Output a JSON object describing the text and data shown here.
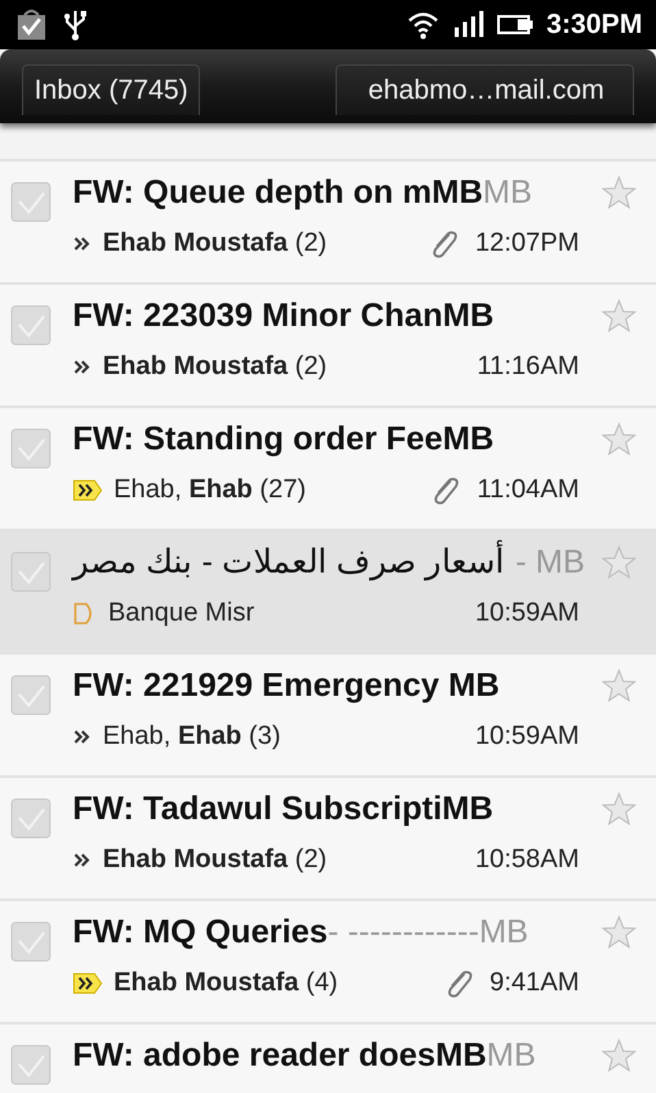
{
  "status_bar": {
    "time": "3:30PM"
  },
  "header": {
    "folder": "Inbox (7745)",
    "account": "ehabmo…mail.com"
  },
  "messages": [
    {
      "subject": "FW: Queue depth on mMB",
      "snippet": "MB",
      "kind": "thread",
      "senders": "**Ehab Moustafa** (2)",
      "attachment": true,
      "time": "12:07PM",
      "unread": true,
      "checked": false,
      "starred": false
    },
    {
      "subject": "FW: 223039 Minor ChanMB",
      "kind": "thread",
      "senders": "**Ehab Moustafa** (2)",
      "attachment": false,
      "time": "11:16AM",
      "unread": true,
      "checked": false,
      "starred": false
    },
    {
      "subject": "FW: Standing order FeeMB",
      "kind": "important",
      "senders": "Ehab, **Ehab** (27)",
      "attachment": true,
      "time": "11:04AM",
      "unread": true,
      "checked": false,
      "starred": false
    },
    {
      "subject": "أسعار صرف العملات - بنك مصر",
      "snippet": "- MB",
      "kind": "label",
      "senders": "Banque Misr",
      "attachment": false,
      "time": "10:59AM",
      "unread": false,
      "checked": false,
      "starred": false
    },
    {
      "subject": "FW: 221929 Emergency MB",
      "kind": "thread",
      "senders": "Ehab, **Ehab** (3)",
      "attachment": false,
      "time": "10:59AM",
      "unread": true,
      "checked": false,
      "starred": false
    },
    {
      "subject": "FW: Tadawul SubscriptiMB",
      "kind": "thread",
      "senders": "**Ehab Moustafa** (2)",
      "attachment": false,
      "time": "10:58AM",
      "unread": true,
      "checked": false,
      "starred": false
    },
    {
      "subject": "FW: MQ Queries",
      "snippet": "- ------------MB",
      "kind": "important",
      "senders": "**Ehab Moustafa** (4)",
      "attachment": true,
      "time": "9:41AM",
      "unread": true,
      "checked": false,
      "starred": false
    },
    {
      "subject": "FW: adobe reader doesMB",
      "snippet": "MB",
      "unread": true,
      "checked": false,
      "starred": false
    }
  ]
}
